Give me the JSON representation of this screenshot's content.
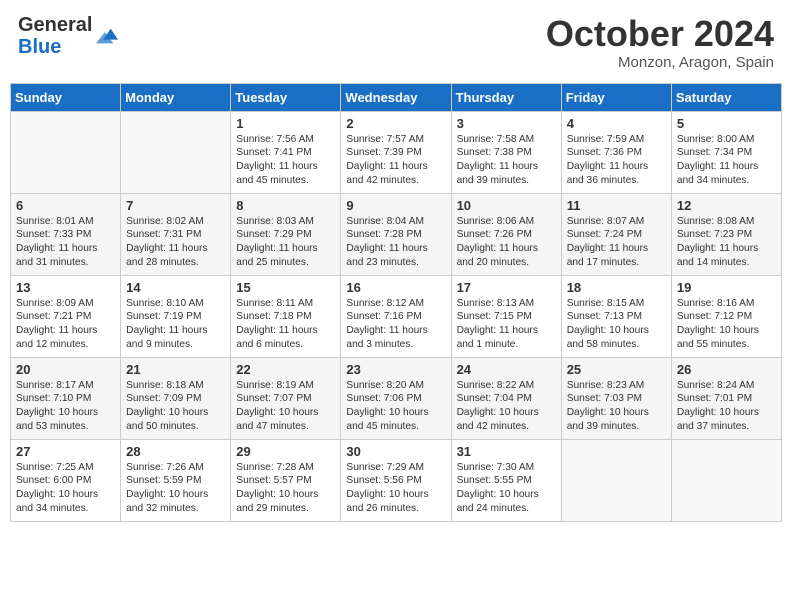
{
  "logo": {
    "general": "General",
    "blue": "Blue"
  },
  "header": {
    "month_year": "October 2024",
    "location": "Monzon, Aragon, Spain"
  },
  "days_of_week": [
    "Sunday",
    "Monday",
    "Tuesday",
    "Wednesday",
    "Thursday",
    "Friday",
    "Saturday"
  ],
  "weeks": [
    [
      {
        "day": "",
        "sunrise": "",
        "sunset": "",
        "daylight": ""
      },
      {
        "day": "",
        "sunrise": "",
        "sunset": "",
        "daylight": ""
      },
      {
        "day": "1",
        "sunrise": "Sunrise: 7:56 AM",
        "sunset": "Sunset: 7:41 PM",
        "daylight": "Daylight: 11 hours and 45 minutes."
      },
      {
        "day": "2",
        "sunrise": "Sunrise: 7:57 AM",
        "sunset": "Sunset: 7:39 PM",
        "daylight": "Daylight: 11 hours and 42 minutes."
      },
      {
        "day": "3",
        "sunrise": "Sunrise: 7:58 AM",
        "sunset": "Sunset: 7:38 PM",
        "daylight": "Daylight: 11 hours and 39 minutes."
      },
      {
        "day": "4",
        "sunrise": "Sunrise: 7:59 AM",
        "sunset": "Sunset: 7:36 PM",
        "daylight": "Daylight: 11 hours and 36 minutes."
      },
      {
        "day": "5",
        "sunrise": "Sunrise: 8:00 AM",
        "sunset": "Sunset: 7:34 PM",
        "daylight": "Daylight: 11 hours and 34 minutes."
      }
    ],
    [
      {
        "day": "6",
        "sunrise": "Sunrise: 8:01 AM",
        "sunset": "Sunset: 7:33 PM",
        "daylight": "Daylight: 11 hours and 31 minutes."
      },
      {
        "day": "7",
        "sunrise": "Sunrise: 8:02 AM",
        "sunset": "Sunset: 7:31 PM",
        "daylight": "Daylight: 11 hours and 28 minutes."
      },
      {
        "day": "8",
        "sunrise": "Sunrise: 8:03 AM",
        "sunset": "Sunset: 7:29 PM",
        "daylight": "Daylight: 11 hours and 25 minutes."
      },
      {
        "day": "9",
        "sunrise": "Sunrise: 8:04 AM",
        "sunset": "Sunset: 7:28 PM",
        "daylight": "Daylight: 11 hours and 23 minutes."
      },
      {
        "day": "10",
        "sunrise": "Sunrise: 8:06 AM",
        "sunset": "Sunset: 7:26 PM",
        "daylight": "Daylight: 11 hours and 20 minutes."
      },
      {
        "day": "11",
        "sunrise": "Sunrise: 8:07 AM",
        "sunset": "Sunset: 7:24 PM",
        "daylight": "Daylight: 11 hours and 17 minutes."
      },
      {
        "day": "12",
        "sunrise": "Sunrise: 8:08 AM",
        "sunset": "Sunset: 7:23 PM",
        "daylight": "Daylight: 11 hours and 14 minutes."
      }
    ],
    [
      {
        "day": "13",
        "sunrise": "Sunrise: 8:09 AM",
        "sunset": "Sunset: 7:21 PM",
        "daylight": "Daylight: 11 hours and 12 minutes."
      },
      {
        "day": "14",
        "sunrise": "Sunrise: 8:10 AM",
        "sunset": "Sunset: 7:19 PM",
        "daylight": "Daylight: 11 hours and 9 minutes."
      },
      {
        "day": "15",
        "sunrise": "Sunrise: 8:11 AM",
        "sunset": "Sunset: 7:18 PM",
        "daylight": "Daylight: 11 hours and 6 minutes."
      },
      {
        "day": "16",
        "sunrise": "Sunrise: 8:12 AM",
        "sunset": "Sunset: 7:16 PM",
        "daylight": "Daylight: 11 hours and 3 minutes."
      },
      {
        "day": "17",
        "sunrise": "Sunrise: 8:13 AM",
        "sunset": "Sunset: 7:15 PM",
        "daylight": "Daylight: 11 hours and 1 minute."
      },
      {
        "day": "18",
        "sunrise": "Sunrise: 8:15 AM",
        "sunset": "Sunset: 7:13 PM",
        "daylight": "Daylight: 10 hours and 58 minutes."
      },
      {
        "day": "19",
        "sunrise": "Sunrise: 8:16 AM",
        "sunset": "Sunset: 7:12 PM",
        "daylight": "Daylight: 10 hours and 55 minutes."
      }
    ],
    [
      {
        "day": "20",
        "sunrise": "Sunrise: 8:17 AM",
        "sunset": "Sunset: 7:10 PM",
        "daylight": "Daylight: 10 hours and 53 minutes."
      },
      {
        "day": "21",
        "sunrise": "Sunrise: 8:18 AM",
        "sunset": "Sunset: 7:09 PM",
        "daylight": "Daylight: 10 hours and 50 minutes."
      },
      {
        "day": "22",
        "sunrise": "Sunrise: 8:19 AM",
        "sunset": "Sunset: 7:07 PM",
        "daylight": "Daylight: 10 hours and 47 minutes."
      },
      {
        "day": "23",
        "sunrise": "Sunrise: 8:20 AM",
        "sunset": "Sunset: 7:06 PM",
        "daylight": "Daylight: 10 hours and 45 minutes."
      },
      {
        "day": "24",
        "sunrise": "Sunrise: 8:22 AM",
        "sunset": "Sunset: 7:04 PM",
        "daylight": "Daylight: 10 hours and 42 minutes."
      },
      {
        "day": "25",
        "sunrise": "Sunrise: 8:23 AM",
        "sunset": "Sunset: 7:03 PM",
        "daylight": "Daylight: 10 hours and 39 minutes."
      },
      {
        "day": "26",
        "sunrise": "Sunrise: 8:24 AM",
        "sunset": "Sunset: 7:01 PM",
        "daylight": "Daylight: 10 hours and 37 minutes."
      }
    ],
    [
      {
        "day": "27",
        "sunrise": "Sunrise: 7:25 AM",
        "sunset": "Sunset: 6:00 PM",
        "daylight": "Daylight: 10 hours and 34 minutes."
      },
      {
        "day": "28",
        "sunrise": "Sunrise: 7:26 AM",
        "sunset": "Sunset: 5:59 PM",
        "daylight": "Daylight: 10 hours and 32 minutes."
      },
      {
        "day": "29",
        "sunrise": "Sunrise: 7:28 AM",
        "sunset": "Sunset: 5:57 PM",
        "daylight": "Daylight: 10 hours and 29 minutes."
      },
      {
        "day": "30",
        "sunrise": "Sunrise: 7:29 AM",
        "sunset": "Sunset: 5:56 PM",
        "daylight": "Daylight: 10 hours and 26 minutes."
      },
      {
        "day": "31",
        "sunrise": "Sunrise: 7:30 AM",
        "sunset": "Sunset: 5:55 PM",
        "daylight": "Daylight: 10 hours and 24 minutes."
      },
      {
        "day": "",
        "sunrise": "",
        "sunset": "",
        "daylight": ""
      },
      {
        "day": "",
        "sunrise": "",
        "sunset": "",
        "daylight": ""
      }
    ]
  ]
}
